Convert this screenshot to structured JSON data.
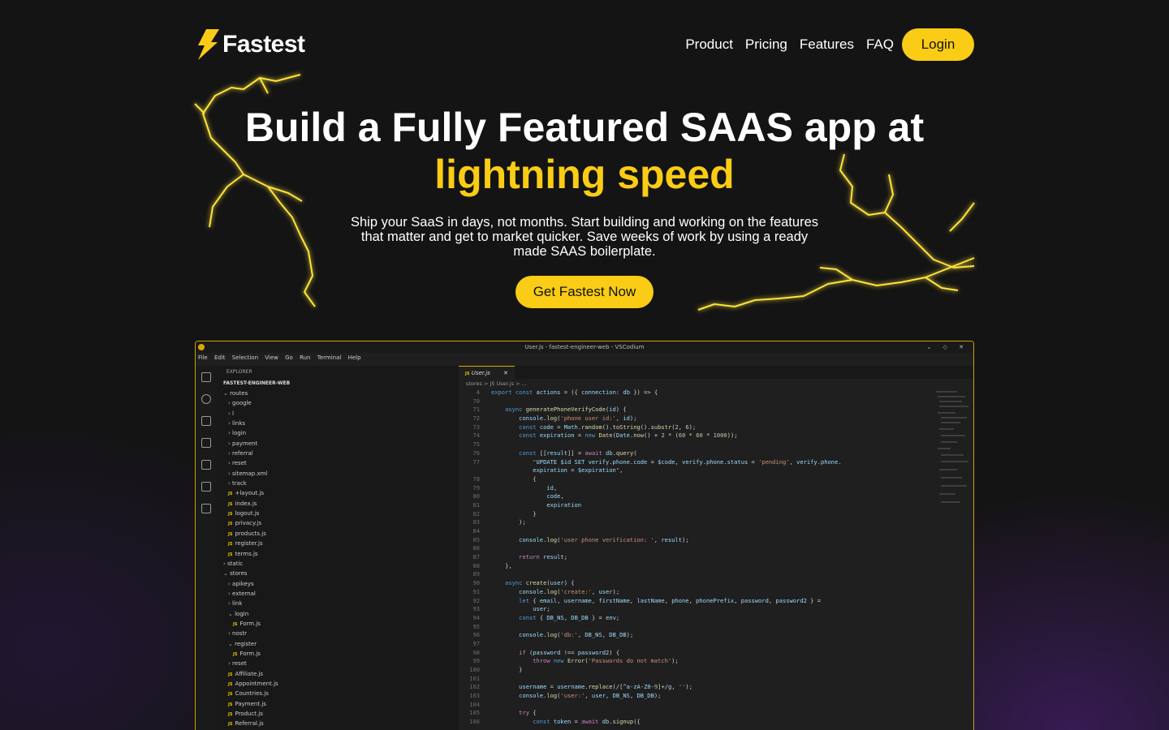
{
  "brand": {
    "name": "Fastest"
  },
  "nav": {
    "items": [
      "Product",
      "Pricing",
      "Features",
      "FAQ"
    ],
    "login": "Login"
  },
  "hero": {
    "title_line1": "Build a Fully Featured SAAS app at",
    "title_line2": "lightning speed",
    "subtitle": "Ship your SaaS in days, not months. Start building and working on the features that matter and get to market quicker. Save weeks of work by using a ready made SAAS boilerplate.",
    "cta": "Get Fastest Now"
  },
  "colors": {
    "accent": "#facc15",
    "background": "#141414"
  },
  "editor": {
    "window_title": "User.js - fastest-engineer-web - VSCodium",
    "menu": [
      "File",
      "Edit",
      "Selection",
      "View",
      "Go",
      "Run",
      "Terminal",
      "Help"
    ],
    "explorer_label": "EXPLORER",
    "project": "FASTEST-ENGINEER-WEB",
    "tree": [
      {
        "indent": 1,
        "type": "folder-open",
        "label": "routes"
      },
      {
        "indent": 2,
        "type": "folder",
        "label": "google"
      },
      {
        "indent": 2,
        "type": "folder",
        "label": "l"
      },
      {
        "indent": 2,
        "type": "folder",
        "label": "links"
      },
      {
        "indent": 2,
        "type": "folder",
        "label": "login"
      },
      {
        "indent": 2,
        "type": "folder",
        "label": "payment"
      },
      {
        "indent": 2,
        "type": "folder",
        "label": "referral"
      },
      {
        "indent": 2,
        "type": "folder",
        "label": "reset"
      },
      {
        "indent": 2,
        "type": "folder",
        "label": "sitemap.xml"
      },
      {
        "indent": 2,
        "type": "folder",
        "label": "track"
      },
      {
        "indent": 2,
        "type": "js",
        "label": "+layout.js"
      },
      {
        "indent": 2,
        "type": "js",
        "label": "index.js"
      },
      {
        "indent": 2,
        "type": "js",
        "label": "logout.js"
      },
      {
        "indent": 2,
        "type": "js",
        "label": "privacy.js"
      },
      {
        "indent": 2,
        "type": "js",
        "label": "products.js"
      },
      {
        "indent": 2,
        "type": "js",
        "label": "register.js"
      },
      {
        "indent": 2,
        "type": "js",
        "label": "terms.js"
      },
      {
        "indent": 1,
        "type": "folder",
        "label": "static"
      },
      {
        "indent": 1,
        "type": "folder-open",
        "label": "stores"
      },
      {
        "indent": 2,
        "type": "folder",
        "label": "apikeys"
      },
      {
        "indent": 2,
        "type": "folder",
        "label": "external"
      },
      {
        "indent": 2,
        "type": "folder",
        "label": "link"
      },
      {
        "indent": 2,
        "type": "folder-open",
        "label": "login"
      },
      {
        "indent": 3,
        "type": "js",
        "label": "Form.js"
      },
      {
        "indent": 2,
        "type": "folder",
        "label": "nostr"
      },
      {
        "indent": 2,
        "type": "folder-open",
        "label": "register"
      },
      {
        "indent": 3,
        "type": "js",
        "label": "Form.js"
      },
      {
        "indent": 2,
        "type": "folder",
        "label": "reset"
      },
      {
        "indent": 2,
        "type": "js",
        "label": "Affiliate.js"
      },
      {
        "indent": 2,
        "type": "js",
        "label": "Appointment.js"
      },
      {
        "indent": 2,
        "type": "js",
        "label": "Countries.js"
      },
      {
        "indent": 2,
        "type": "js",
        "label": "Payment.js"
      },
      {
        "indent": 2,
        "type": "js",
        "label": "Product.js"
      },
      {
        "indent": 2,
        "type": "js",
        "label": "Referral.js"
      }
    ],
    "tab": "User.js",
    "breadcrumb": "stores > JS User.js > ...",
    "code_lines": [
      [
        "4",
        "export const actions = ({ connection: db }) => {"
      ],
      [
        "70",
        ""
      ],
      [
        "71",
        "    async generatePhoneVerifyCode(id) {"
      ],
      [
        "72",
        "        console.log('phone user id:', id);"
      ],
      [
        "73",
        "        const code = Math.random().toString().substr(2, 6);"
      ],
      [
        "74",
        "        const expiration = new Date(Date.now() + 2 * (60 * 60 * 1000));"
      ],
      [
        "75",
        ""
      ],
      [
        "76",
        "        const [[result]] = await db.query("
      ],
      [
        "77",
        "            \"UPDATE $id SET verify.phone.code = $code, verify.phone.status = 'pending', verify.phone."
      ],
      [
        "",
        "            expiration = $expiration\","
      ],
      [
        "78",
        "            {"
      ],
      [
        "79",
        "                id,"
      ],
      [
        "80",
        "                code,"
      ],
      [
        "81",
        "                expiration"
      ],
      [
        "82",
        "            }"
      ],
      [
        "83",
        "        );"
      ],
      [
        "84",
        ""
      ],
      [
        "85",
        "        console.log('user phone verification: ', result);"
      ],
      [
        "86",
        ""
      ],
      [
        "87",
        "        return result;"
      ],
      [
        "88",
        "    },"
      ],
      [
        "89",
        ""
      ],
      [
        "90",
        "    async create(user) {"
      ],
      [
        "91",
        "        console.log('create:', user);"
      ],
      [
        "92",
        "        let { email, username, firstName, lastName, phone, phonePrefix, password, password2 } ="
      ],
      [
        "93",
        "            user;"
      ],
      [
        "94",
        "        const { DB_NS, DB_DB } = env;"
      ],
      [
        "95",
        ""
      ],
      [
        "96",
        "        console.log('db:', DB_NS, DB_DB);"
      ],
      [
        "97",
        ""
      ],
      [
        "98",
        "        if (password !== password2) {"
      ],
      [
        "99",
        "            throw new Error('Passwords do not match');"
      ],
      [
        "100",
        "        }"
      ],
      [
        "101",
        ""
      ],
      [
        "102",
        "        username = username.replace(/[^a-zA-Z0-9]+/g, '');"
      ],
      [
        "103",
        "        console.log('user:', user, DB_NS, DB_DB);"
      ],
      [
        "104",
        ""
      ],
      [
        "105",
        "        try {"
      ],
      [
        "106",
        "            const token = await db.signup({"
      ]
    ]
  }
}
